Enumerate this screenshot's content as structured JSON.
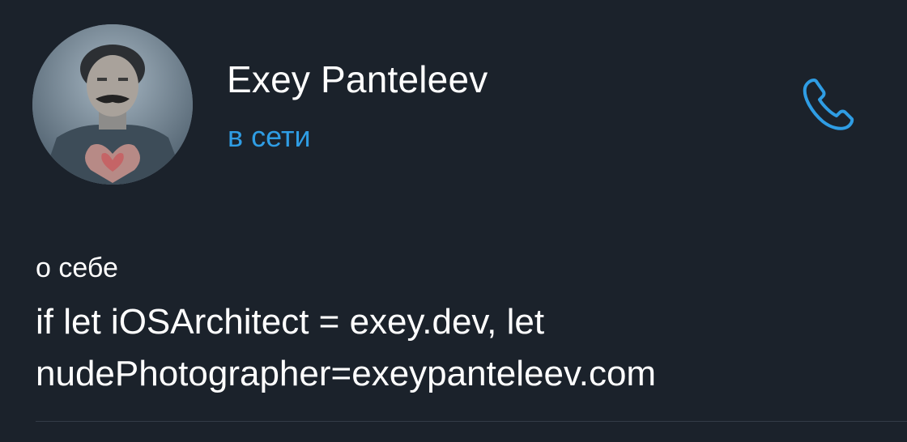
{
  "profile": {
    "name": "Exey Panteleev",
    "status": "в сети",
    "status_color": "#2f9de4"
  },
  "header": {
    "call_icon": "phone-icon"
  },
  "about": {
    "label": "о себе",
    "text": "if let iOSArchitect = exey.dev, let\nnudePhotographer=exeypanteleev.com"
  },
  "colors": {
    "background": "#1b222b",
    "accent": "#2f9de4",
    "text": "#ffffff",
    "divider": "#343c47"
  }
}
